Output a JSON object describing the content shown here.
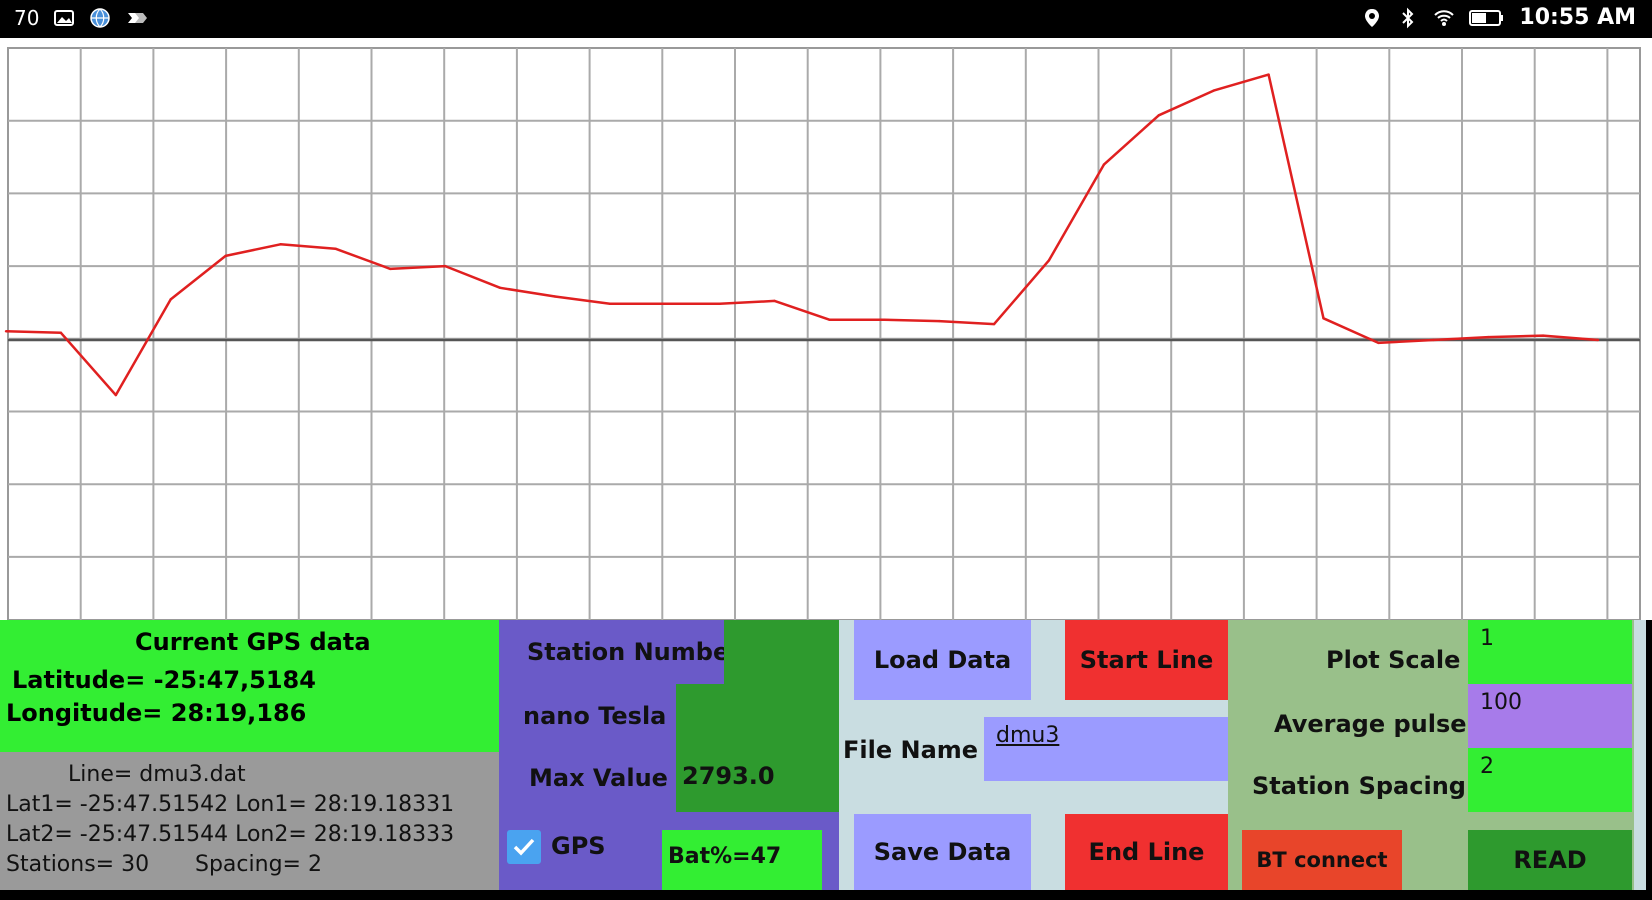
{
  "status_bar": {
    "notification_count": "70",
    "time": "10:55 AM",
    "icons_left": [
      "image-icon",
      "globe-icon",
      "cast-icon"
    ],
    "icons_right": [
      "location-icon",
      "bluetooth-icon",
      "wifi-icon",
      "battery-icon"
    ]
  },
  "gps_panel": {
    "title": "Current GPS data",
    "latitude": "Latitude= -25:47,5184",
    "longitude": "Longitude= 28:19,186"
  },
  "line_info": {
    "line": "Line= dmu3.dat",
    "lat1_lon1": "Lat1= -25:47.51542 Lon1= 28:19.18331",
    "lat2_lon2": "Lat2= -25:47.51544 Lon2= 28:19.18333",
    "stations": "Stations= 30",
    "spacing": "Spacing= 2"
  },
  "readings": {
    "station_number_label": "Station Number",
    "station_number_value": "",
    "nano_tesla_label": "nano Tesla",
    "nano_tesla_value": "",
    "max_value_label": "Max Value",
    "max_value": "2793.0",
    "gps_label": "GPS",
    "gps_checked": true,
    "battery": "Bat%=47"
  },
  "file_controls": {
    "load_data": "Load Data",
    "start_line": "Start Line",
    "file_name_label": "File Name",
    "file_name_value": "dmu3",
    "save_data": "Save Data",
    "end_line": "End Line"
  },
  "settings": {
    "plot_scale_label": "Plot Scale",
    "plot_scale_value": "1",
    "average_pulse_label": "Average pulse",
    "average_pulse_value": "100",
    "station_spacing_label": "Station Spacing",
    "station_spacing_value": "2",
    "bt_connect": "BT connect",
    "read": "READ"
  },
  "colors": {
    "trace": "#e02020",
    "green_bright": "#33ee33",
    "green_dark": "#2e9a2e",
    "purple": "#6a5ac8",
    "lavender": "#9b9bff",
    "red": "#f03030",
    "sage": "#99c08a",
    "grey": "#9a9a9a",
    "light_blue_grey": "#c9dde1"
  },
  "chart_data": {
    "type": "line",
    "title": "",
    "xlabel": "",
    "ylabel": "",
    "grid": true,
    "series": [
      {
        "name": "",
        "x": [
          0,
          1,
          2,
          3,
          4,
          5,
          6,
          7,
          8,
          9,
          10,
          11,
          12,
          13,
          14,
          15,
          16,
          17,
          18,
          19,
          20,
          21,
          22,
          23,
          24,
          25,
          26,
          27,
          28,
          29
        ],
        "values": [
          0.06,
          0.05,
          -0.38,
          0.28,
          0.58,
          0.66,
          0.63,
          0.49,
          0.51,
          0.36,
          0.3,
          0.25,
          0.25,
          0.25,
          0.27,
          0.14,
          0.14,
          0.13,
          0.11,
          0.55,
          1.21,
          1.55,
          1.72,
          1.83,
          0.15,
          -0.02,
          0.0,
          0.02,
          0.03,
          0.0
        ]
      }
    ],
    "xlim": [
      0,
      29
    ],
    "ylim": [
      -2.0,
      2.0
    ]
  }
}
